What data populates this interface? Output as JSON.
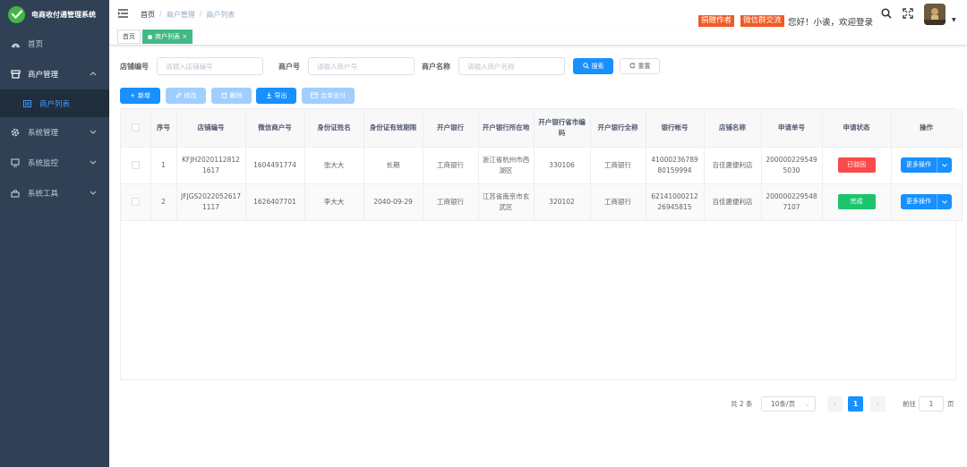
{
  "app": {
    "title": "电商收付通管理系统",
    "brand_color": "#44b549"
  },
  "sidebar": {
    "items": [
      {
        "label": "首页",
        "icon": "dashboard-icon"
      },
      {
        "label": "商户管理",
        "icon": "shop-icon",
        "expanded": true
      },
      {
        "label": "商户列表",
        "icon": "list-icon",
        "active": true
      },
      {
        "label": "系统管理",
        "icon": "gear-icon"
      },
      {
        "label": "系统监控",
        "icon": "monitor-icon"
      },
      {
        "label": "系统工具",
        "icon": "toolbox-icon"
      }
    ]
  },
  "header": {
    "breadcrumb": [
      "首页",
      "商户管理",
      "商户列表"
    ],
    "separator": "/",
    "tag_sponsor": "捐赠作者",
    "tag_wechat": "微信群交流",
    "welcome": "您好！小诶，欢迎登录"
  },
  "tabs": [
    {
      "label": "首页"
    },
    {
      "label": "商户列表",
      "close": "×",
      "active": true
    }
  ],
  "search": {
    "store_no": {
      "label": "店铺编号",
      "placeholder": "请输入店铺编号"
    },
    "merchant_no": {
      "label": "商户号",
      "placeholder": "请输入商户号"
    },
    "merchant_name": {
      "label": "商户名称",
      "placeholder": "请输入商户名称"
    },
    "search_label": "搜索",
    "reset_label": "重置"
  },
  "toolbar": {
    "add_label": "新增",
    "edit_label": "修改",
    "delete_label": "删除",
    "export_label": "导出",
    "combine_label": "合单支付"
  },
  "table": {
    "columns": [
      "序号",
      "店铺编号",
      "微信商户号",
      "身份证姓名",
      "身份证有效期限",
      "开户银行",
      "开户银行所在地",
      "开户银行省市编码",
      "开户银行全称",
      "银行帐号",
      "店铺名称",
      "申请单号",
      "申请状态",
      "操作"
    ],
    "rows": [
      {
        "index": "1",
        "store_no": "KFJH20201128121617",
        "wx_merchant": "1604491774",
        "id_name": "张大大",
        "id_expire": "长期",
        "bank": "工商银行",
        "bank_location": "浙江省杭州市西湖区",
        "bank_code": "330106",
        "bank_fullname": "工商银行",
        "bank_account": "4100023678980159994",
        "store_name": "百佳惠便利店",
        "apply_no": "2000002295495030",
        "status": "已驳回",
        "status_color": "#f94b4b",
        "action": "更多操作"
      },
      {
        "index": "2",
        "store_no": "JFJGS20220526171117",
        "wx_merchant": "1626407701",
        "id_name": "李大大",
        "id_expire": "2040-09-29",
        "bank": "工商银行",
        "bank_location": "江苏省南京市玄武区",
        "bank_code": "320102",
        "bank_fullname": "工商银行",
        "bank_account": "6214100021226945815",
        "store_name": "百佳惠便利店",
        "apply_no": "2000002295487107",
        "status": "完成",
        "status_color": "#1ec46c",
        "action": "更多操作"
      }
    ]
  },
  "pagination": {
    "total": "共 2 条",
    "page_size": "10条/页",
    "prev": "‹",
    "next": "›",
    "current": "1",
    "goto_label": "前往",
    "goto_value": "1",
    "page_suffix": "页"
  }
}
